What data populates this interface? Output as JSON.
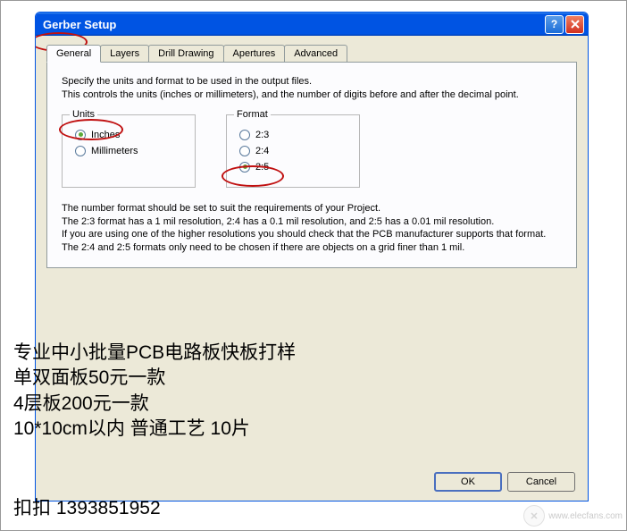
{
  "window": {
    "title": "Gerber Setup"
  },
  "tabs": [
    {
      "label": "General",
      "active": true
    },
    {
      "label": "Layers",
      "active": false
    },
    {
      "label": "Drill Drawing",
      "active": false
    },
    {
      "label": "Apertures",
      "active": false
    },
    {
      "label": "Advanced",
      "active": false
    }
  ],
  "description": {
    "line1": "Specify the units and format to be used in the output files.",
    "line2": "This controls the units (inches or millimeters), and the number of digits before and after the decimal point."
  },
  "units": {
    "legend": "Units",
    "options": [
      {
        "label": "Inches",
        "selected": true
      },
      {
        "label": "Millimeters",
        "selected": false
      }
    ]
  },
  "format": {
    "legend": "Format",
    "options": [
      {
        "label": "2:3",
        "selected": false
      },
      {
        "label": "2:4",
        "selected": false
      },
      {
        "label": "2:5",
        "selected": true
      }
    ]
  },
  "note": {
    "l1": "The number format should be set to suit the requirements of your Project.",
    "l2": "The 2:3 format has a 1 mil resolution, 2:4 has a 0.1 mil resolution, and 2:5 has a 0.01 mil resolution.",
    "l3": "If you are using one of the higher resolutions you should check that the PCB manufacturer supports that format.",
    "l4": "The 2:4 and 2:5 formats only need to be chosen if there are objects on a grid finer than 1 mil."
  },
  "overlay": {
    "line1": "专业中小批量PCB电路板快板打样",
    "line2": "单双面板50元一款",
    "line3": "4层板200元一款",
    "line4": "10*10cm以内 普通工艺 10片",
    "line5": "扣扣 1393851952"
  },
  "buttons": {
    "ok": "OK",
    "cancel": "Cancel"
  },
  "watermark": {
    "text": "www.elecfans.com"
  }
}
